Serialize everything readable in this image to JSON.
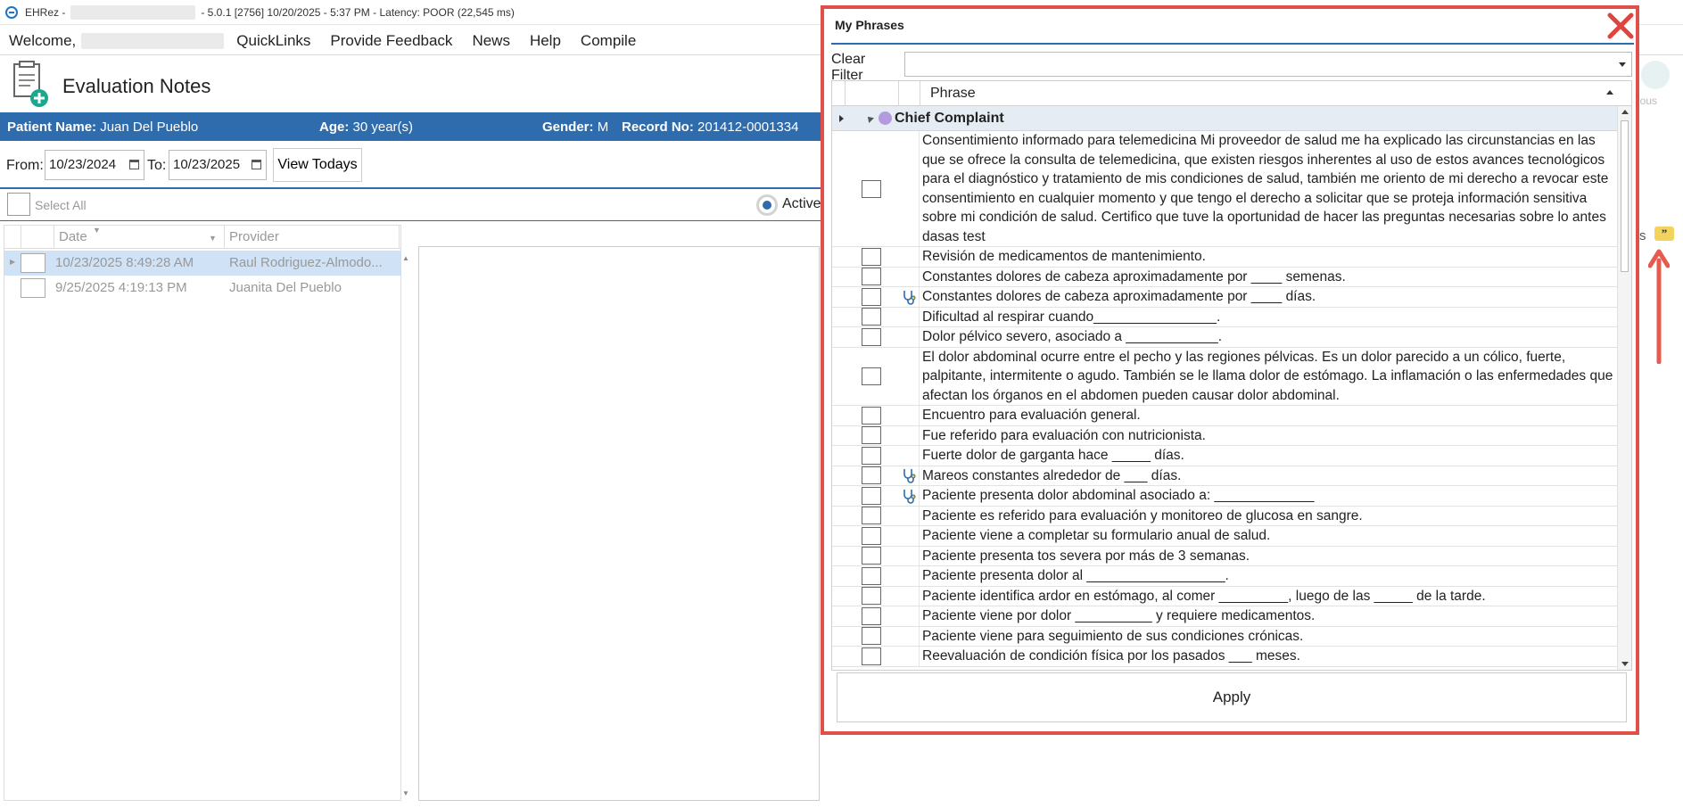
{
  "titlebar": {
    "app_name": "EHRez -",
    "info": "- 5.0.1 [2756] 10/20/2025 - 5:37 PM - Latency: POOR (22,545 ms)"
  },
  "menu": {
    "welcome": "Welcome,",
    "items": [
      "QuickLinks",
      "Provide Feedback",
      "News",
      "Help",
      "Compile"
    ]
  },
  "page": {
    "title": "Evaluation Notes"
  },
  "patient": {
    "name_label": "Patient Name:",
    "name": "Juan Del Pueblo",
    "age_label": "Age:",
    "age": "30 year(s)",
    "gender_label": "Gender:",
    "gender": "M",
    "record_label": "Record No:",
    "record": "201412-0001334"
  },
  "filter": {
    "from_label": "From:",
    "from_value": "10/23/2024",
    "to_label": "To:",
    "to_value": "10/23/2025",
    "view_todays": "View Todays",
    "select_all": "Select All",
    "active": "Active"
  },
  "grid": {
    "headers": [
      "Date",
      "Provider"
    ],
    "rows": [
      {
        "date": "10/23/2025 8:49:28 AM",
        "provider": "Raul Rodriguez-Almodo..."
      },
      {
        "date": "9/25/2025 4:19:13 PM",
        "provider": "Juanita Del Pueblo"
      }
    ]
  },
  "right_stub": {
    "label": "ious",
    "side_label": "s"
  },
  "modal": {
    "title": "My Phrases",
    "clear_filter": "Clear Filter",
    "filter_value": "",
    "column_header": "Phrase",
    "group": "Chief Complaint",
    "apply": "Apply",
    "phrases": [
      {
        "text": "Consentimiento informado para telemedicina  Mi proveedor de salud me ha explicado las circunstancias en las que se ofrece la consulta de telemedicina, que existen riesgos inherentes al uso de estos avances tecnológicos para el diagnóstico y tratamiento de mis condiciones de salud, también me oriento de mi derecho a revocar este consentimiento en cualquier momento y que tengo el derecho a solicitar que se proteja información sensitiva sobre mi condición de salud.  Certifico que tuve la oportunidad de hacer las preguntas necesarias sobre lo antes dasas test",
        "icon": ""
      },
      {
        "text": "  Revisión de medicamentos de mantenimiento.",
        "icon": ""
      },
      {
        "text": "Constantes dolores de cabeza aproximadamente por ____ semenas.",
        "icon": ""
      },
      {
        "text": "Constantes dolores de cabeza aproximadamente por ____ días.",
        "icon": "stethoscope-icon"
      },
      {
        "text": "Dificultad al respirar cuando________________.",
        "icon": ""
      },
      {
        "text": "Dolor pélvico severo, asociado a ____________.",
        "icon": ""
      },
      {
        "text": "El dolor abdominal ocurre entre el pecho y las regiones pélvicas. Es un dolor parecido a un cólico, fuerte, palpitante, intermitente o agudo. También se le llama dolor de estómago. La inflamación o las enfermedades que afectan los órganos en el abdomen pueden causar dolor abdominal.",
        "icon": ""
      },
      {
        "text": "Encuentro para evaluación general.",
        "icon": ""
      },
      {
        "text": "Fue referido para evaluación con nutricionista.",
        "icon": ""
      },
      {
        "text": "Fuerte dolor de garganta hace _____ días.",
        "icon": ""
      },
      {
        "text": "Mareos constantes alrededor de ___ días.",
        "icon": "stethoscope-icon"
      },
      {
        "text": "Paciente presenta dolor abdominal asociado a: _____________",
        "icon": "stethoscope-icon"
      },
      {
        "text": "Paciente es referido para evaluación y monitoreo de glucosa en sangre.",
        "icon": ""
      },
      {
        "text": "Paciente viene a completar su formulario anual de salud.",
        "icon": ""
      },
      {
        "text": "Paciente presenta tos severa por más de 3 semanas.",
        "icon": ""
      },
      {
        "text": "Paciente presenta dolor al __________________.",
        "icon": ""
      },
      {
        "text": "Paciente identifica ardor en estómago, al comer _________, luego de las _____ de la tarde.",
        "icon": ""
      },
      {
        "text": "Paciente viene por dolor __________ y requiere medicamentos.",
        "icon": ""
      },
      {
        "text": "Paciente viene para seguimiento de sus condiciones crónicas.",
        "icon": ""
      },
      {
        "text": "Reevaluación de condición física por los pasados ___ meses.",
        "icon": ""
      }
    ]
  },
  "colors": {
    "accent": "#2f6cad",
    "highlight": "#e0504a"
  }
}
